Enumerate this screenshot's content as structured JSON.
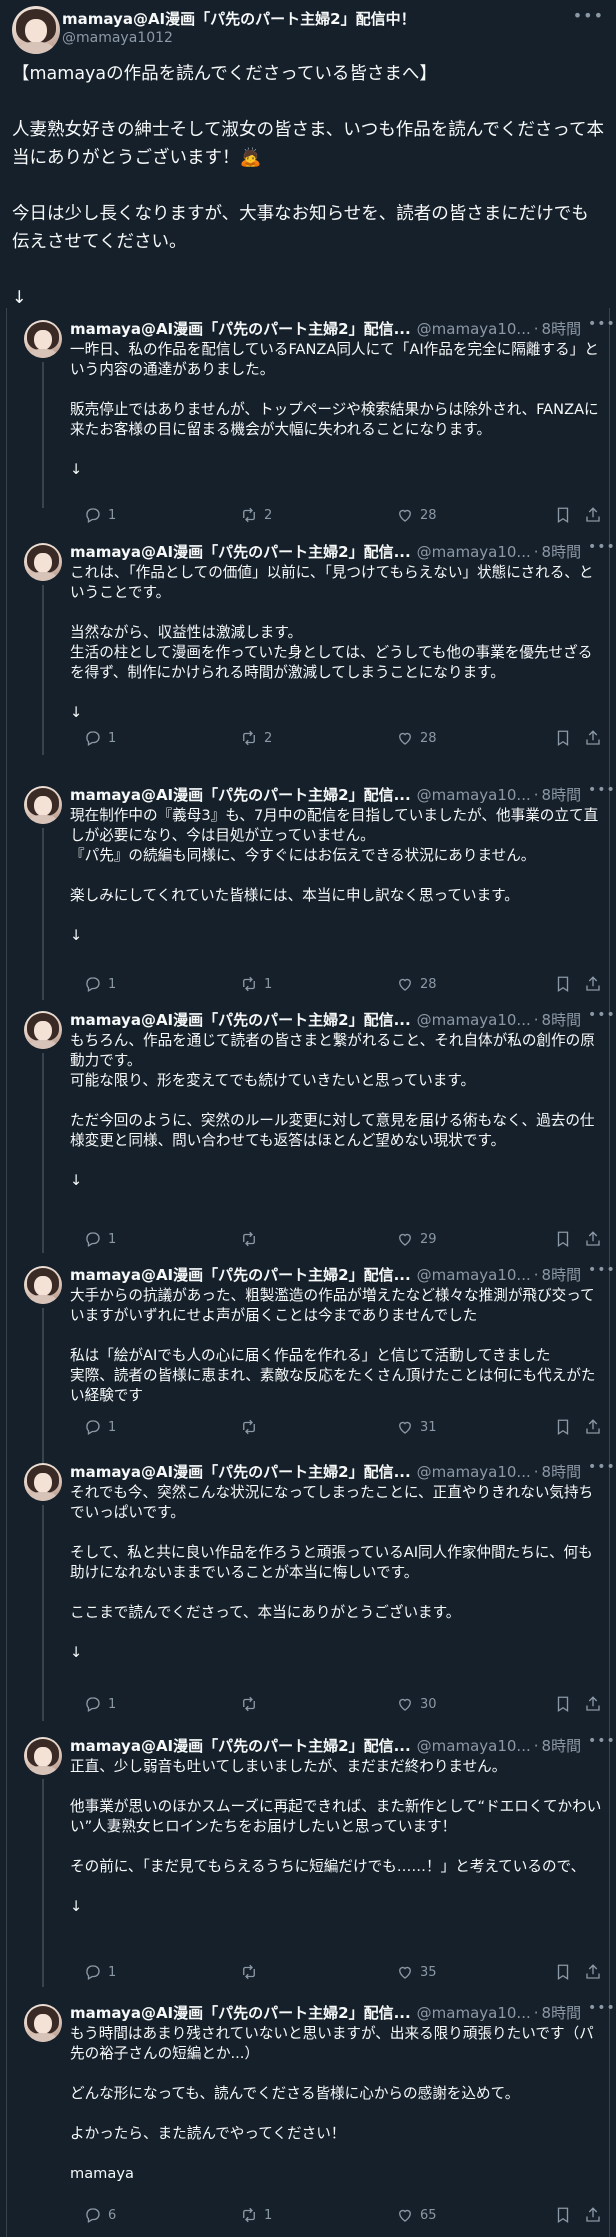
{
  "main": {
    "name": "mamaya@AI漫画「パ先のパート主婦2」配信中！",
    "handle": "@mamaya1012",
    "text": "【mamayaの作品を読んでくださっている皆さまへ】\n\n人妻熟女好きの紳士そして淑女の皆さま、いつも作品を読んでくださって本当にありがとうございます！🙇\n\n今日は少し長くなりますが、大事なお知らせを、読者の皆さまにだけでも伝えさせてください。\n\n↓"
  },
  "reply_defaults": {
    "name": "mamaya@AI漫画「パ先のパート主婦2」配信...",
    "handle": "@mamaya10...",
    "dot": "·",
    "time": "8時間"
  },
  "replies": [
    {
      "text": "一昨日、私の作品を配信しているFANZA同人にて「AI作品を完全に隔離する」という内容の通達がありました。\n\n販売停止ではありませんが、トップページや検索結果からは除外され、FANZAに来たお客様の目に留まる機会が大幅に失われることになります。\n\n↓",
      "replies": "1",
      "retweets": "2",
      "likes": "28"
    },
    {
      "text": "これは、「作品としての価値」以前に、「見つけてもらえない」状態にされる、ということです。\n\n当然ながら、収益性は激減します。\n生活の柱として漫画を作っていた身としては、どうしても他の事業を優先せざるを得ず、制作にかけられる時間が激減してしまうことになります。\n\n↓",
      "replies": "1",
      "retweets": "2",
      "likes": "28"
    },
    {
      "text": "現在制作中の『義母3』も、7月中の配信を目指していましたが、他事業の立て直しが必要になり、今は目処が立っていません。\n『パ先』の続編も同様に、今すぐにはお伝えできる状況にありません。\n\n楽しみにしてくれていた皆様には、本当に申し訳なく思っています。\n\n↓",
      "replies": "1",
      "retweets": "1",
      "likes": "28"
    },
    {
      "text": "もちろん、作品を通じて読者の皆さまと繋がれること、それ自体が私の創作の原動力です。\n可能な限り、形を変えてでも続けていきたいと思っています。\n\nただ今回のように、突然のルール変更に対して意見を届ける術もなく、過去の仕様変更と同様、問い合わせても返答はほとんど望めない現状です。\n\n↓",
      "replies": "1",
      "retweets": "",
      "likes": "29"
    },
    {
      "text": "大手からの抗議があった、粗製濫造の作品が増えたなど様々な推測が飛び交っていますがいずれにせよ声が届くことは今までありませんでした\n\n私は「絵がAIでも人の心に届く作品を作れる」と信じて活動してきました\n実際、読者の皆様に恵まれ、素敵な反応をたくさん頂けたことは何にも代えがたい経験です",
      "replies": "1",
      "retweets": "",
      "likes": "31"
    },
    {
      "text": "それでも今、突然こんな状況になってしまったことに、正直やりきれない気持ちでいっぱいです。\n\nそして、私と共に良い作品を作ろうと頑張っているAI同人作家仲間たちに、何も助けになれないままでいることが本当に悔しいです。\n\nここまで読んでくださって、本当にありがとうございます。\n\n↓",
      "replies": "1",
      "retweets": "",
      "likes": "30"
    },
    {
      "text": "正直、少し弱音も吐いてしまいましたが、まだまだ終わりません。\n\n他事業が思いのほかスムーズに再起できれば、また新作として“ドエロくてかわいい”人妻熟女ヒロインたちをお届けしたいと思っています！\n\nその前に、「まだ見てもらえるうちに短編だけでも……！」と考えているので、\n\n↓",
      "replies": "1",
      "retweets": "",
      "likes": "35"
    },
    {
      "text": "もう時間はあまり残されていないと思いますが、出来る限り頑張りたいです（パ先の裕子さんの短編とか...）\n\nどんな形になっても、読んでくださる皆様に心からの感謝を込めて。\n\nよかったら、また読んでやってください！\n\nmamaya",
      "replies": "6",
      "retweets": "1",
      "likes": "65"
    }
  ],
  "icons": {
    "more": "more-icon",
    "reply": "reply-icon",
    "retweet": "retweet-icon",
    "like": "heart-icon",
    "bookmark": "bookmark-icon",
    "share": "share-icon"
  }
}
